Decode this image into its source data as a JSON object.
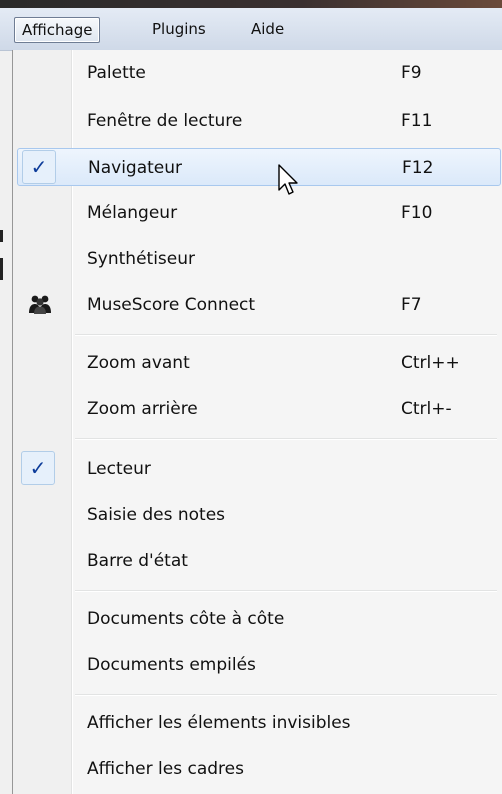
{
  "menubar": {
    "items": [
      {
        "label": "Affichage"
      },
      {
        "label": "Plugins"
      },
      {
        "label": "Aide"
      }
    ]
  },
  "menu": {
    "items": [
      {
        "label": "Palette",
        "shortcut": "F9"
      },
      {
        "label": "Fenêtre de lecture",
        "shortcut": "F11"
      },
      {
        "label": "Navigateur",
        "shortcut": "F12",
        "checked": true
      },
      {
        "label": "Mélangeur",
        "shortcut": "F10"
      },
      {
        "label": "Synthétiseur",
        "shortcut": ""
      },
      {
        "label": "MuseScore Connect",
        "shortcut": "F7",
        "icon": "people-icon"
      },
      {
        "label": "Zoom avant",
        "shortcut": "Ctrl++"
      },
      {
        "label": "Zoom arrière",
        "shortcut": "Ctrl+-"
      },
      {
        "label": "Lecteur",
        "shortcut": "",
        "checked": true
      },
      {
        "label": "Saisie des notes",
        "shortcut": ""
      },
      {
        "label": "Barre d'état",
        "shortcut": ""
      },
      {
        "label": "Documents côte à côte",
        "shortcut": ""
      },
      {
        "label": "Documents empilés",
        "shortcut": ""
      },
      {
        "label": "Afficher les élements invisibles",
        "shortcut": ""
      },
      {
        "label": "Afficher les cadres",
        "shortcut": ""
      }
    ],
    "check_glyph": "✓",
    "hover_item": "Navigateur"
  },
  "colors": {
    "menubar": "#cfd9e8",
    "hover_border": "#a8c8ee",
    "check": "#0d3c9a"
  }
}
